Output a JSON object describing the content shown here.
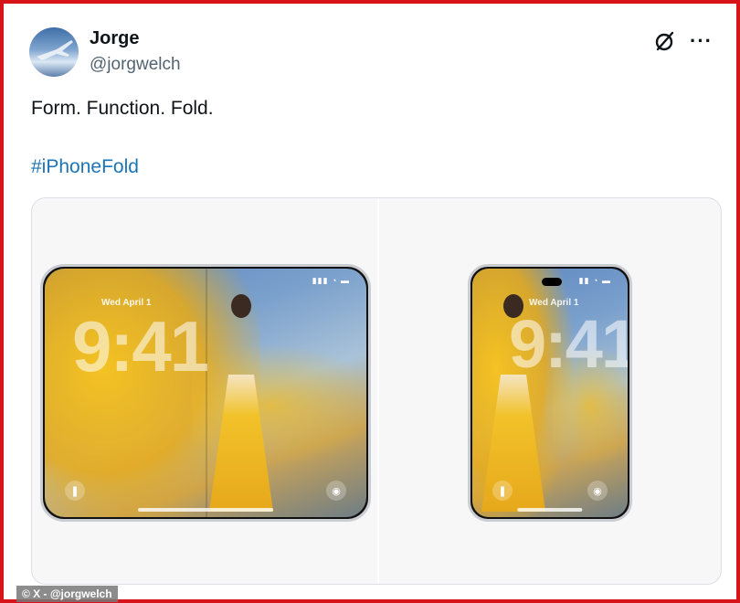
{
  "author": {
    "name": "Jorge",
    "handle": "@jorgwelch"
  },
  "tweet": {
    "text": "Form. Function. Fold.",
    "hashtag": "#iPhoneFold"
  },
  "actions": {
    "grok_icon": "grok-icon",
    "more_label": "···"
  },
  "media": {
    "phones": [
      {
        "date": "Wed April 1",
        "time": "9:41"
      },
      {
        "date": "Wed April 1",
        "time": "9:41"
      }
    ]
  },
  "credit": "© X - @jorgwelch",
  "colors": {
    "frame_border": "#d7141a",
    "hashtag": "#1d74b5",
    "name": "#0f1419",
    "handle": "#536471"
  }
}
